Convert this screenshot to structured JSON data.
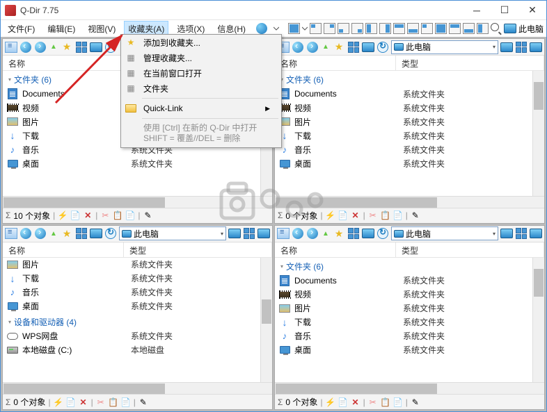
{
  "window": {
    "title": "Q-Dir 7.75"
  },
  "menu": {
    "file": "文件(F)",
    "edit": "编辑(E)",
    "view": "视图(V)",
    "fav": "收藏夹(A)",
    "options": "选项(X)",
    "info": "信息(H)",
    "thispc_right": "此电脑"
  },
  "dropdown": {
    "add": "添加到收藏夹...",
    "manage": "管理收藏夹...",
    "open_current": "在当前窗口打开",
    "folders": "文件夹",
    "quicklink": "Quick-Link",
    "hint1": "使用 [Ctrl] 在新的 Q-Dir 中打开",
    "hint2": "SHIFT = 覆盖//DEL = 删除"
  },
  "cols": {
    "name": "名称",
    "type": "类型"
  },
  "addr": {
    "thispc": "此电脑"
  },
  "groups": {
    "folders6": "文件夹 (6)",
    "devices4": "设备和驱动器 (4)"
  },
  "types": {
    "sysfolder": "系统文件夹",
    "localdisk": "本地磁盘"
  },
  "items": {
    "documents": "Documents",
    "video": "视频",
    "picture": "图片",
    "download": "下载",
    "music": "音乐",
    "desktop": "桌面",
    "wps": "WPS网盘",
    "cdisk": "本地磁盘 (C:)"
  },
  "status": {
    "p1": "10 个对象",
    "p2": "0 个对象",
    "p3": "0 个对象",
    "p4": "0 个对象"
  }
}
